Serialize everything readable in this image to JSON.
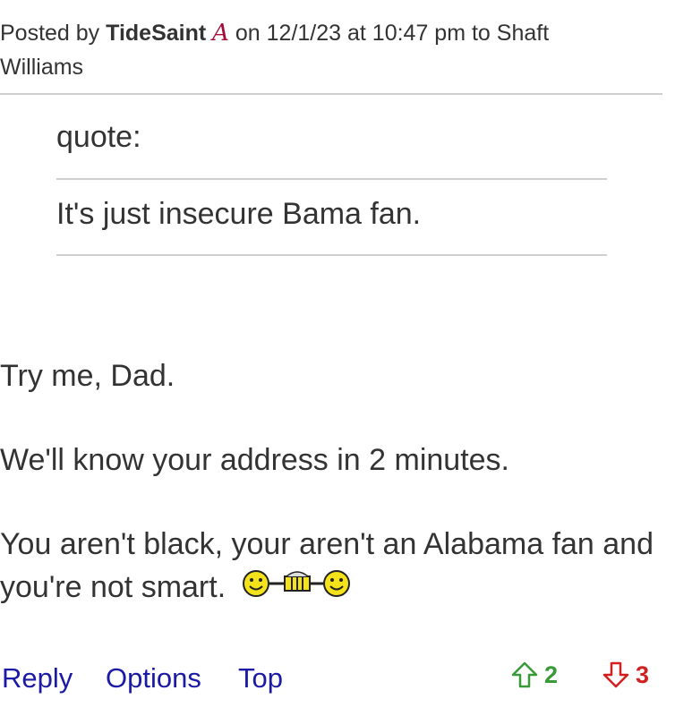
{
  "post": {
    "prefix": "Posted by",
    "author": "TideSaint",
    "team_logo": "A",
    "mid_text": "on 12/1/23 at 10:47 pm to Shaft Williams"
  },
  "quote": {
    "label": "quote:",
    "text": "It's just insecure Bama fan."
  },
  "body": {
    "line1": "Try me, Dad.",
    "line2": "We'll know your address in 2 minutes.",
    "line3": "You aren't black, your aren't an Alabama fan and you're not smart."
  },
  "actions": {
    "reply": "Reply",
    "options": "Options",
    "top": "Top"
  },
  "votes": {
    "up": "2",
    "down": "3"
  },
  "colors": {
    "link": "#1a1aa6",
    "upvote": "#3a9a3a",
    "downvote": "#d12020",
    "logo": "#a30b3a"
  }
}
